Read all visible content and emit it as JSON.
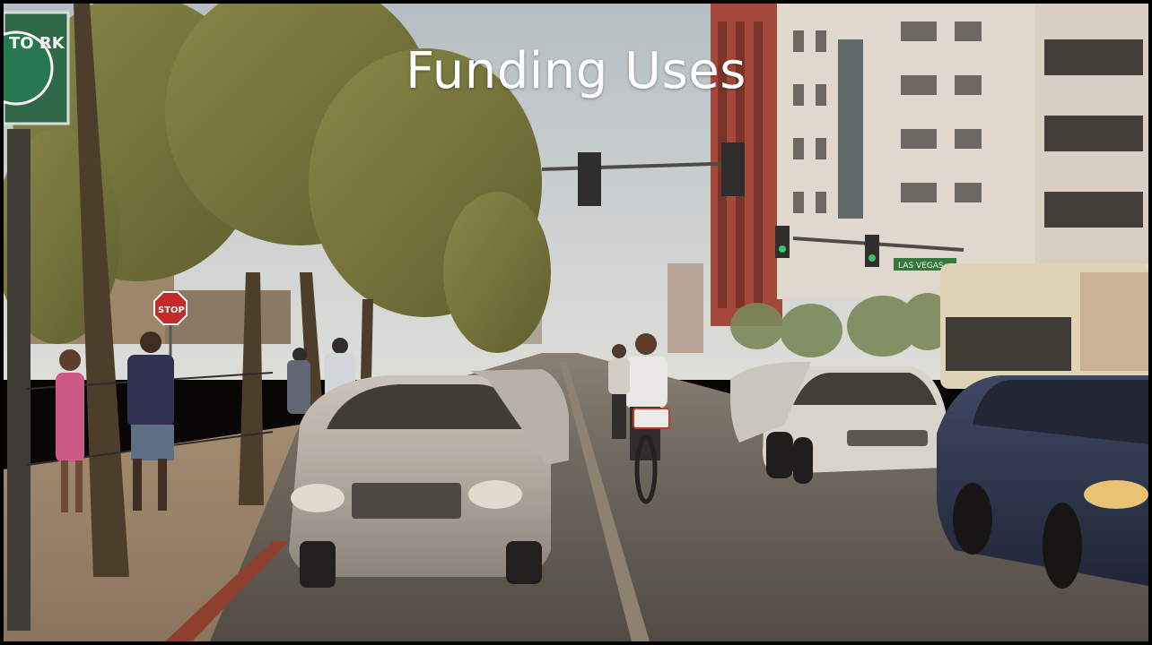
{
  "slide": {
    "title": "Funding Uses"
  },
  "photo": {
    "subject": "downtown street scene with trees, pedestrians, parked cars, cyclist and bus",
    "signs": {
      "stop": "STOP",
      "street": "LAS VEGAS",
      "freeway_partial": "TO RK"
    }
  }
}
